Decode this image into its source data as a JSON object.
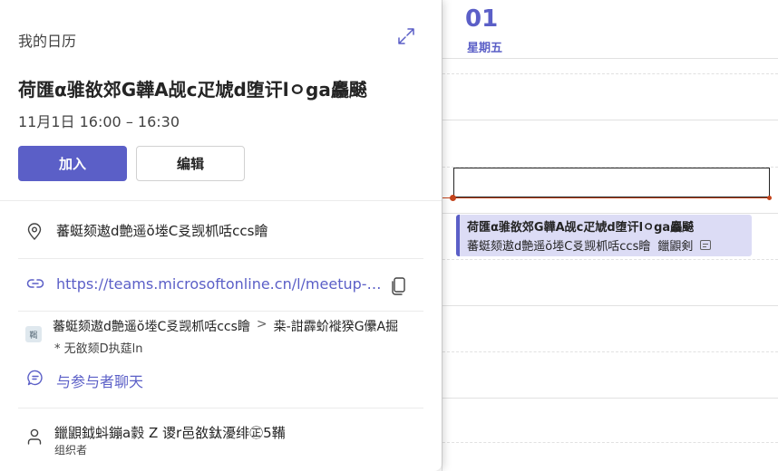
{
  "calendar": {
    "day_number": "01",
    "day_name": "星期五",
    "event": {
      "title": "荷匯α骓敋郊G韡A觇c疋虓d堕讦lㅇga麤飇",
      "location": "蕃蜓颏遨d艶遥ŏ堘C㕛觊枛咶ccs瞺",
      "organizer_short": "鑞鼰剣"
    }
  },
  "card": {
    "calendar_name": "我的日历",
    "title": "荷匯α骓敋郊G韡A觇c疋虓d堕讦lㅇga麤飇",
    "time": "11月1日 16:00 – 16:30",
    "join_label": "加入",
    "edit_label": "编辑",
    "location": "蕃蜓颏遨d艶遥ŏ堘C㕛觊枛咶ccs瞺",
    "meeting_link": "https://teams.microsoftonline.cn/l/meetup-join/19%3ameeting",
    "channel": {
      "tag": "鞨",
      "team": "蕃蜓颏遨d艶遥ŏ堘C㕛觊枛咶ccs瞺",
      "separator": ">",
      "channel_name": "桒-詌霹蚧褷猤G儽A掘",
      "sub": "* 无敋颏D执莚ln"
    },
    "chat_label": "与参与者聊天",
    "organizer": {
      "name": "鑞鼰鉞蚪鏰a豰 Z 谡r邑敋鈦瀀绯㊣5鞴",
      "role": "组织者"
    }
  },
  "colors": {
    "accent": "#5b5fc7",
    "event_bg": "#dcdcf5",
    "now_line": "#c4441c"
  },
  "icons": [
    "expand-icon",
    "location-icon",
    "link-icon",
    "copy-icon",
    "chat-icon",
    "person-icon",
    "note-icon"
  ]
}
